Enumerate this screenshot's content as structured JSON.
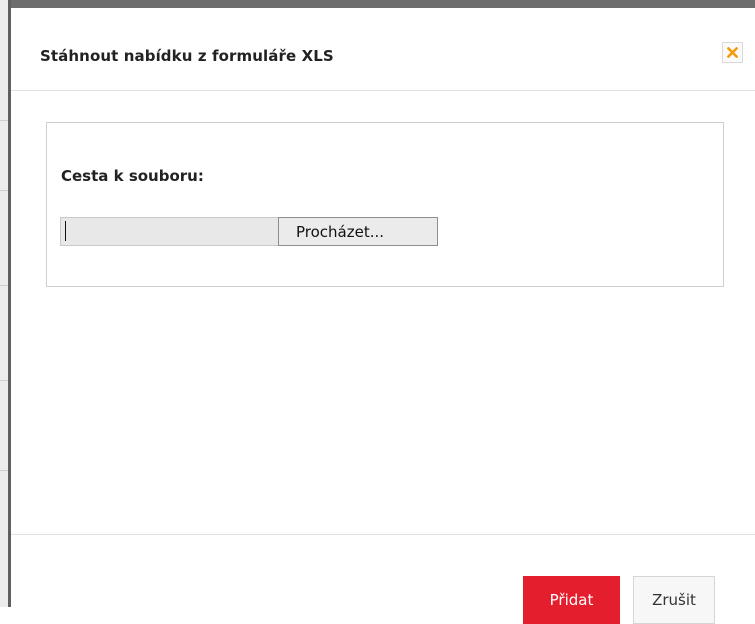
{
  "dialog": {
    "title": "Stáhnout nabídku z formuláře XLS",
    "close_icon": "close-x-icon",
    "accent_color": "#f39c12"
  },
  "form": {
    "file_label": "Cesta k souboru:",
    "file_value": "",
    "browse_label": "Procházet..."
  },
  "footer": {
    "submit_label": "Přidat",
    "cancel_label": "Zrušit",
    "submit_color": "#e41e2d"
  }
}
